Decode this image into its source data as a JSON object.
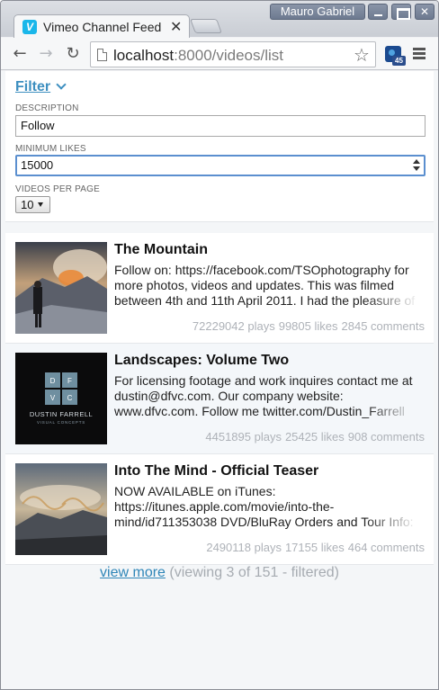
{
  "window": {
    "user_name": "Mauro Gabriel"
  },
  "tab": {
    "favicon_letter": "V",
    "title": "Vimeo Channel Feed",
    "close_glyph": "✕"
  },
  "toolbar": {
    "back_glyph": "←",
    "forward_glyph": "→",
    "reload_glyph": "↻",
    "url_host": "localhost",
    "url_rest": ":8000/videos/list",
    "star_glyph": "☆",
    "extension_badge": "45"
  },
  "filter": {
    "heading": "Filter",
    "description_label": "DESCRIPTION",
    "description_value": "Follow",
    "min_likes_label": "MINIMUM LIKES",
    "min_likes_value": "15000",
    "per_page_label": "VIDEOS PER PAGE",
    "per_page_value": "10"
  },
  "videos": [
    {
      "title": "The Mountain",
      "description": "Follow on: https://facebook.com/TSOphotography for more photos, videos and updates. This was filmed between 4th and 11th April 2011. I had the pleasure of",
      "plays": "72229042 plays",
      "likes": "99805 likes",
      "comments": "2845 comments"
    },
    {
      "title": "Landscapes: Volume Two",
      "description": "For licensing footage and work inquires contact me at dustin@dfvc.com. Our company website: www.dfvc.com. Follow me twitter.com/Dustin_Farrell",
      "plays": "4451895 plays",
      "likes": "25425 likes",
      "comments": "908 comments",
      "thumb_text": {
        "cells": [
          "D",
          "F",
          "V",
          "C"
        ],
        "name": "DUSTIN FARRELL",
        "sub": "VISUAL CONCEPTS"
      }
    },
    {
      "title": "Into The Mind - Official Teaser",
      "description": "NOW AVAILABLE on iTunes: https://itunes.apple.com/movie/into-the-mind/id711353038 DVD/BluRay Orders and Tour Info:",
      "plays": "2490118 plays",
      "likes": "17155 likes",
      "comments": "464 comments"
    }
  ],
  "footer": {
    "more_link": "view more",
    "viewing": "(viewing 3 of 151 - filtered)"
  }
}
